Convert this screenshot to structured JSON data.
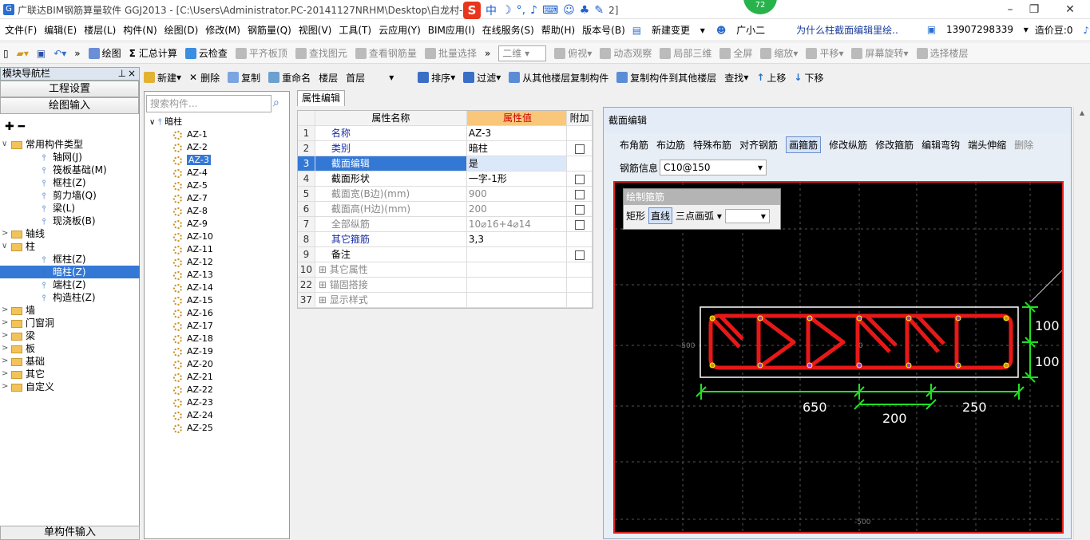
{
  "window": {
    "title": "广联达BIM钢筋算量软件 GGJ2013 - [C:\\Users\\Administrator.PC-20141127NRHM\\Desktop\\白龙村-",
    "title_tail": "2]",
    "badge": "72"
  },
  "menu": [
    "文件(F)",
    "编辑(E)",
    "楼层(L)",
    "构件(N)",
    "绘图(D)",
    "修改(M)",
    "钢筋量(Q)",
    "视图(V)",
    "工具(T)",
    "云应用(Y)",
    "BIM应用(I)",
    "在线服务(S)",
    "帮助(H)",
    "版本号(B)"
  ],
  "menu_right": {
    "change": "新建变更",
    "helper": "广小二",
    "question": "为什么柱截面编辑里绘..",
    "phone": "13907298339",
    "price": "造价豆:0"
  },
  "toolbar1": {
    "draw": "绘图",
    "sum": "汇总计算",
    "cloud": "云检查",
    "flat": "平齐板顶",
    "find_elem": "查找图元",
    "view_steel": "查看钢筋量",
    "batch": "批量选择",
    "view_mode": "二维",
    "top_view": "俯视",
    "dynamic": "动态观察",
    "local3d": "局部三维",
    "fullscreen": "全屏",
    "zoom": "缩放",
    "pan": "平移",
    "rotate": "屏幕旋转",
    "select_floor": "选择楼层"
  },
  "toolbar2": {
    "new": "新建",
    "delete": "删除",
    "copy": "复制",
    "rename": "重命名",
    "floor_label": "楼层",
    "floor_value": "首层",
    "sort": "排序",
    "filter": "过滤",
    "copy_from": "从其他楼层复制构件",
    "copy_to": "复制构件到其他楼层",
    "find": "查找",
    "up": "上移",
    "down": "下移"
  },
  "nav": {
    "header": "模块导航栏",
    "pin": "ᵖ",
    "close": "×",
    "project_settings": "工程设置",
    "drawing_input": "绘图输入",
    "single_input": "单构件输入"
  },
  "tree": [
    {
      "label": "常用构件类型",
      "level": 0,
      "exp": "∨",
      "type": "folder"
    },
    {
      "label": "轴网(J)",
      "level": 1,
      "type": "item"
    },
    {
      "label": "筏板基础(M)",
      "level": 1,
      "type": "item"
    },
    {
      "label": "框柱(Z)",
      "level": 1,
      "type": "item"
    },
    {
      "label": "剪力墙(Q)",
      "level": 1,
      "type": "item"
    },
    {
      "label": "梁(L)",
      "level": 1,
      "type": "item"
    },
    {
      "label": "现浇板(B)",
      "level": 1,
      "type": "item"
    },
    {
      "label": "轴线",
      "level": 0,
      "exp": ">",
      "type": "folder"
    },
    {
      "label": "柱",
      "level": 0,
      "exp": "∨",
      "type": "folder"
    },
    {
      "label": "框柱(Z)",
      "level": 1,
      "type": "item"
    },
    {
      "label": "暗柱(Z)",
      "level": 1,
      "type": "item",
      "sel": true
    },
    {
      "label": "端柱(Z)",
      "level": 1,
      "type": "item"
    },
    {
      "label": "构造柱(Z)",
      "level": 1,
      "type": "item"
    },
    {
      "label": "墙",
      "level": 0,
      "exp": ">",
      "type": "folder"
    },
    {
      "label": "门窗洞",
      "level": 0,
      "exp": ">",
      "type": "folder"
    },
    {
      "label": "梁",
      "level": 0,
      "exp": ">",
      "type": "folder"
    },
    {
      "label": "板",
      "level": 0,
      "exp": ">",
      "type": "folder"
    },
    {
      "label": "基础",
      "level": 0,
      "exp": ">",
      "type": "folder"
    },
    {
      "label": "其它",
      "level": 0,
      "exp": ">",
      "type": "folder"
    },
    {
      "label": "自定义",
      "level": 0,
      "exp": ">",
      "type": "folder"
    }
  ],
  "component": {
    "search_placeholder": "搜索构件...",
    "root": "暗柱",
    "items": [
      "AZ-1",
      "AZ-2",
      "AZ-3",
      "AZ-4",
      "AZ-5",
      "AZ-7",
      "AZ-8",
      "AZ-9",
      "AZ-10",
      "AZ-11",
      "AZ-12",
      "AZ-13",
      "AZ-14",
      "AZ-15",
      "AZ-16",
      "AZ-17",
      "AZ-18",
      "AZ-19",
      "AZ-20",
      "AZ-21",
      "AZ-22",
      "AZ-23",
      "AZ-24",
      "AZ-25"
    ],
    "selected": "AZ-3"
  },
  "props": {
    "tab": "属性编辑",
    "headers": [
      "属性名称",
      "属性值",
      "附加"
    ],
    "rows": [
      {
        "no": "1",
        "name": "名称",
        "value": "AZ-3",
        "style": "blue",
        "chk": false
      },
      {
        "no": "2",
        "name": "类别",
        "value": "暗柱",
        "style": "blue",
        "chk": true
      },
      {
        "no": "3",
        "name": "截面编辑",
        "value": "是",
        "style": "sel",
        "chk": false
      },
      {
        "no": "4",
        "name": "截面形状",
        "value": "一字-1形",
        "style": "",
        "chk": true
      },
      {
        "no": "5",
        "name": "截面宽(B边)(mm)",
        "value": "900",
        "style": "gray",
        "chk": true
      },
      {
        "no": "6",
        "name": "截面高(H边)(mm)",
        "value": "200",
        "style": "gray",
        "chk": true
      },
      {
        "no": "7",
        "name": "全部纵筋",
        "value": "10⌀16+4⌀14",
        "style": "gray",
        "chk": true
      },
      {
        "no": "8",
        "name": "其它箍筋",
        "value": "3,3",
        "style": "blue",
        "chk": false
      },
      {
        "no": "9",
        "name": "备注",
        "value": "",
        "style": "",
        "chk": true
      },
      {
        "no": "10",
        "name": "其它属性",
        "value": "",
        "style": "gray",
        "chk": false,
        "plus": true
      },
      {
        "no": "22",
        "name": "锚固搭接",
        "value": "",
        "style": "gray",
        "chk": false,
        "plus": true
      },
      {
        "no": "37",
        "name": "显示样式",
        "value": "",
        "style": "gray",
        "chk": false,
        "plus": true
      }
    ]
  },
  "section": {
    "title": "截面编辑",
    "tools": [
      "布角筋",
      "布边筋",
      "特殊布筋",
      "对齐钢筋",
      "画箍筋",
      "修改纵筋",
      "修改箍筋",
      "编辑弯钩",
      "端头伸缩",
      "删除"
    ],
    "active_tool": "画箍筋",
    "rebar_label": "钢筋信息",
    "rebar_value": "C10@150",
    "draw_box": {
      "title": "绘制箍筋",
      "rect": "矩形",
      "line": "直线",
      "arc": "三点画弧"
    },
    "dims": {
      "left": "650",
      "mid": "200",
      "right": "250",
      "top": "100",
      "bottom": "100",
      "coord_left": "-500",
      "coord_center": "0",
      "coord_bottom": "-500"
    }
  },
  "colors": {
    "rebar": "#e81818",
    "canvas": "#000000",
    "dim": "#22e022"
  }
}
